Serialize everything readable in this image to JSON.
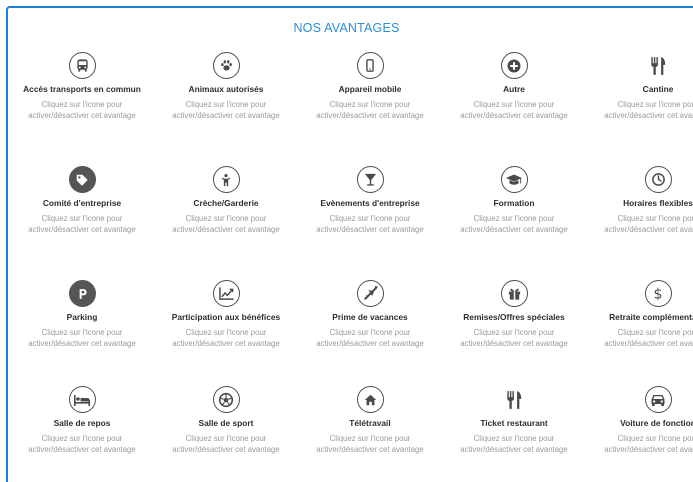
{
  "title": "NOS AVANTAGES",
  "accent_color": "#1e7fd3",
  "benefits": [
    {
      "label": "Accès transports en commun",
      "icon": "bus-icon",
      "style": "outline",
      "hint": "Cliquez sur l'icone pour activer/désactiver cet avantage"
    },
    {
      "label": "Animaux autorisés",
      "icon": "paw-icon",
      "style": "outline",
      "hint": "Cliquez sur l'icone pour activer/désactiver cet avantage"
    },
    {
      "label": "Appareil mobile",
      "icon": "mobile-phone-icon",
      "style": "outline",
      "hint": "Cliquez sur l'icone pour activer/désactiver cet avantage"
    },
    {
      "label": "Autre",
      "icon": "plus-icon",
      "style": "outline",
      "hint": "Cliquez sur l'icone pour activer/désactiver cet avantage"
    },
    {
      "label": "Cantine",
      "icon": "cutlery-icon",
      "style": "none",
      "hint": "Cliquez sur l'icone pour activer/désactiver cet avantage"
    },
    {
      "label": "Comité d'entreprise",
      "icon": "tag-icon",
      "style": "filled",
      "hint": "Cliquez sur l'icone pour activer/désactiver cet avantage"
    },
    {
      "label": "Crèche/Garderie",
      "icon": "child-icon",
      "style": "outline",
      "hint": "Cliquez sur l'icone pour activer/désactiver cet avantage"
    },
    {
      "label": "Evènements d'entreprise",
      "icon": "cocktail-glass-icon",
      "style": "outline",
      "hint": "Cliquez sur l'icone pour activer/désactiver cet avantage"
    },
    {
      "label": "Formation",
      "icon": "graduation-cap-icon",
      "style": "outline",
      "hint": "Cliquez sur l'icone pour activer/désactiver cet avantage"
    },
    {
      "label": "Horaires flexibles",
      "icon": "clock-icon",
      "style": "outline",
      "hint": "Cliquez sur l'icone pour activer/désactiver cet avantage"
    },
    {
      "label": "Parking",
      "icon": "parking-icon",
      "style": "filled",
      "hint": "Cliquez sur l'icone pour activer/désactiver cet avantage"
    },
    {
      "label": "Participation aux bénéfices",
      "icon": "line-chart-icon",
      "style": "outline",
      "hint": "Cliquez sur l'icone pour activer/désactiver cet avantage"
    },
    {
      "label": "Prime de vacances",
      "icon": "airplane-icon",
      "style": "outline",
      "hint": "Cliquez sur l'icone pour activer/désactiver cet avantage"
    },
    {
      "label": "Remises/Offres spéciales",
      "icon": "gift-icon",
      "style": "outline",
      "hint": "Cliquez sur l'icone pour activer/désactiver cet avantage"
    },
    {
      "label": "Retraite complémentaire",
      "icon": "dollar-icon",
      "style": "outline",
      "hint": "Cliquez sur l'icone pour activer/désactiver cet avantage"
    },
    {
      "label": "Salle de repos",
      "icon": "bed-icon",
      "style": "outline",
      "hint": "Cliquez sur l'icone pour activer/désactiver cet avantage"
    },
    {
      "label": "Salle de sport",
      "icon": "football-icon",
      "style": "outline",
      "hint": "Cliquez sur l'icone pour activer/désactiver cet avantage"
    },
    {
      "label": "Télétravail",
      "icon": "home-icon",
      "style": "outline",
      "hint": "Cliquez sur l'icone pour activer/désactiver cet avantage"
    },
    {
      "label": "Ticket restaurant",
      "icon": "cutlery-icon",
      "style": "none",
      "hint": "Cliquez sur l'icone pour activer/désactiver cet avantage"
    },
    {
      "label": "Voiture de fonction",
      "icon": "car-icon",
      "style": "outline",
      "hint": "Cliquez sur l'icone pour activer/désactiver cet avantage"
    }
  ]
}
